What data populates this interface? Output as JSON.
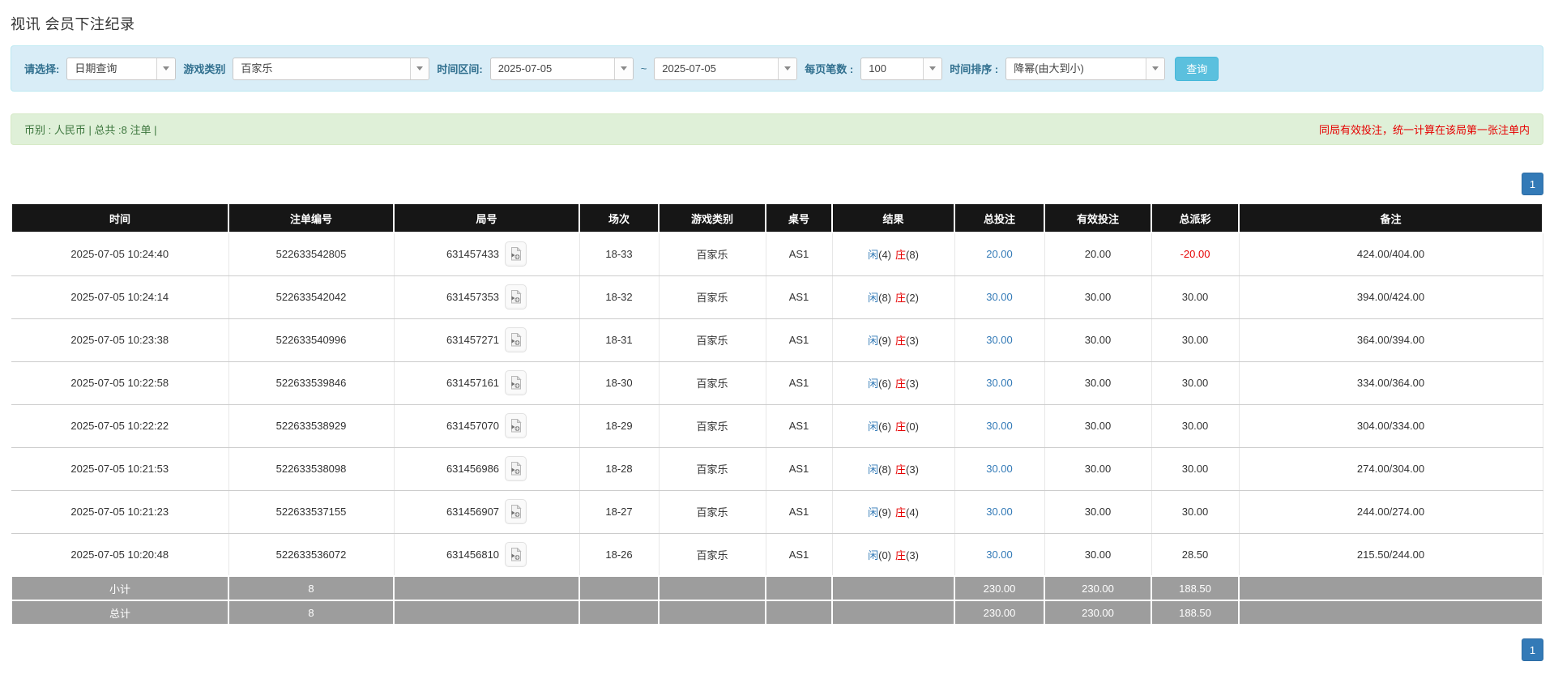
{
  "page": {
    "title": "视讯 会员下注纪录"
  },
  "filters": {
    "select_label": "请选择:",
    "select_value": "日期查询",
    "game_type_label": "游戏类别",
    "game_type_value": "百家乐",
    "time_range_label": "时间区间:",
    "date_from": "2025-07-05",
    "tilde": "~",
    "date_to": "2025-07-05",
    "page_size_label": "每页笔数 :",
    "page_size_value": "100",
    "sort_label": "时间排序 :",
    "sort_value": "降幂(由大到小)",
    "search_button": "查询"
  },
  "summary": {
    "left": "币别 : 人民币 | 总共 :8 注单 |",
    "right": "同局有效投注，统一计算在该局第一张注单内"
  },
  "pagination": {
    "page": "1"
  },
  "colors": {
    "accent_blue": "#337ab7",
    "negative_red": "#e60000",
    "summary_green_text": "#3c763d",
    "summary_green_bg": "#dff0d8",
    "filter_panel_bg": "#d9edf7",
    "table_header_bg": "#161616",
    "subtotal_gray_bg": "#9d9d9d",
    "search_button_bg": "#5bc0de"
  },
  "table": {
    "headers": [
      "时间",
      "注单编号",
      "局号",
      "场次",
      "游戏类别",
      "桌号",
      "结果",
      "总投注",
      "有效投注",
      "总派彩",
      "备注"
    ],
    "rows": [
      {
        "time": "2025-07-05 10:24:40",
        "bet_id": "522633542805",
        "round_id": "631457433",
        "session": "18-33",
        "game": "百家乐",
        "table_no": "AS1",
        "player": "闲",
        "player_score": "(4)",
        "banker": "庄",
        "banker_score": "(8)",
        "total_bet": "20.00",
        "valid_bet": "20.00",
        "payout": "-20.00",
        "remark": "424.00/404.00"
      },
      {
        "time": "2025-07-05 10:24:14",
        "bet_id": "522633542042",
        "round_id": "631457353",
        "session": "18-32",
        "game": "百家乐",
        "table_no": "AS1",
        "player": "闲",
        "player_score": "(8)",
        "banker": "庄",
        "banker_score": "(2)",
        "total_bet": "30.00",
        "valid_bet": "30.00",
        "payout": "30.00",
        "remark": "394.00/424.00"
      },
      {
        "time": "2025-07-05 10:23:38",
        "bet_id": "522633540996",
        "round_id": "631457271",
        "session": "18-31",
        "game": "百家乐",
        "table_no": "AS1",
        "player": "闲",
        "player_score": "(9)",
        "banker": "庄",
        "banker_score": "(3)",
        "total_bet": "30.00",
        "valid_bet": "30.00",
        "payout": "30.00",
        "remark": "364.00/394.00"
      },
      {
        "time": "2025-07-05 10:22:58",
        "bet_id": "522633539846",
        "round_id": "631457161",
        "session": "18-30",
        "game": "百家乐",
        "table_no": "AS1",
        "player": "闲",
        "player_score": "(6)",
        "banker": "庄",
        "banker_score": "(3)",
        "total_bet": "30.00",
        "valid_bet": "30.00",
        "payout": "30.00",
        "remark": "334.00/364.00"
      },
      {
        "time": "2025-07-05 10:22:22",
        "bet_id": "522633538929",
        "round_id": "631457070",
        "session": "18-29",
        "game": "百家乐",
        "table_no": "AS1",
        "player": "闲",
        "player_score": "(6)",
        "banker": "庄",
        "banker_score": "(0)",
        "total_bet": "30.00",
        "valid_bet": "30.00",
        "payout": "30.00",
        "remark": "304.00/334.00"
      },
      {
        "time": "2025-07-05 10:21:53",
        "bet_id": "522633538098",
        "round_id": "631456986",
        "session": "18-28",
        "game": "百家乐",
        "table_no": "AS1",
        "player": "闲",
        "player_score": "(8)",
        "banker": "庄",
        "banker_score": "(3)",
        "total_bet": "30.00",
        "valid_bet": "30.00",
        "payout": "30.00",
        "remark": "274.00/304.00"
      },
      {
        "time": "2025-07-05 10:21:23",
        "bet_id": "522633537155",
        "round_id": "631456907",
        "session": "18-27",
        "game": "百家乐",
        "table_no": "AS1",
        "player": "闲",
        "player_score": "(9)",
        "banker": "庄",
        "banker_score": "(4)",
        "total_bet": "30.00",
        "valid_bet": "30.00",
        "payout": "30.00",
        "remark": "244.00/274.00"
      },
      {
        "time": "2025-07-05 10:20:48",
        "bet_id": "522633536072",
        "round_id": "631456810",
        "session": "18-26",
        "game": "百家乐",
        "table_no": "AS1",
        "player": "闲",
        "player_score": "(0)",
        "banker": "庄",
        "banker_score": "(3)",
        "total_bet": "30.00",
        "valid_bet": "30.00",
        "payout": "28.50",
        "remark": "215.50/244.00"
      }
    ],
    "subtotal": {
      "label": "小计",
      "count": "8",
      "total_bet": "230.00",
      "valid_bet": "230.00",
      "payout": "188.50"
    },
    "total": {
      "label": "总计",
      "count": "8",
      "total_bet": "230.00",
      "valid_bet": "230.00",
      "payout": "188.50"
    }
  }
}
